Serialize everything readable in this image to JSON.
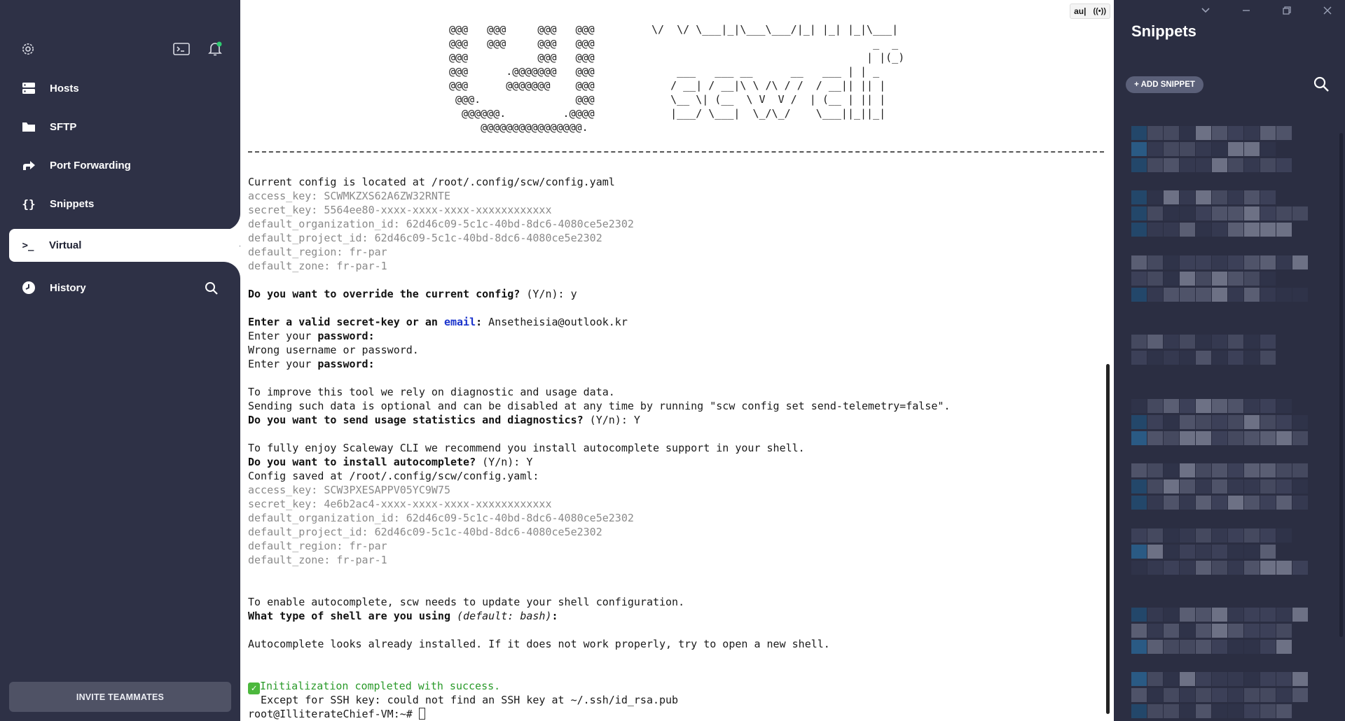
{
  "sidebar": {
    "nav": [
      {
        "label": "Hosts",
        "icon": "hosts-icon"
      },
      {
        "label": "SFTP",
        "icon": "folder-icon"
      },
      {
        "label": "Port Forwarding",
        "icon": "port-forwarding-icon"
      },
      {
        "label": "Snippets",
        "icon": "braces-icon"
      },
      {
        "label": "Virtual",
        "icon": "terminal-prompt-icon"
      },
      {
        "label": "History",
        "icon": "clock-icon"
      }
    ],
    "invite_label": "INVITE TEAMMATES",
    "active_item": "Virtual"
  },
  "terminal": {
    "ascii_left": [
      "@@@   @@@     @@@   @@@",
      "@@@   @@@     @@@   @@@",
      "@@@           @@@   @@@",
      "@@@      .@@@@@@@   @@@",
      "@@@      @@@@@@@    @@@",
      " @@@.               @@@",
      "  @@@@@@.         .@@@@",
      "     @@@@@@@@@@@@@@@@."
    ],
    "ascii_right": [
      "\\/  \\/ \\___|_|\\___\\___/|_| |_| |_|\\___|",
      "                                   _  _",
      "                                  | |(_)",
      "    ___   ___ __      __   ___ | | _",
      "   / __| / __|\\ \\ /\\ / /  / __|| || |",
      "   \\__ \\| (__  \\ V  V /  | (__ | || |",
      "   |___/ \\___|  \\_/\\_/    \\___||_||_|"
    ],
    "lines": [
      {
        "text": "Current config is located at /root/.config/scw/config.yaml"
      },
      {
        "text": "access_key: SCWMKZXS62A6ZW32RNTE",
        "dim": true
      },
      {
        "text": "secret_key: 5564ee80-xxxx-xxxx-xxxx-xxxxxxxxxxxx",
        "dim": true
      },
      {
        "text": "default_organization_id: 62d46c09-5c1c-40bd-8dc6-4080ce5e2302",
        "dim": true
      },
      {
        "text": "default_project_id: 62d46c09-5c1c-40bd-8dc6-4080ce5e2302",
        "dim": true
      },
      {
        "text": "default_region: fr-par",
        "dim": true
      },
      {
        "text": "default_zone: fr-par-1",
        "dim": true
      },
      {
        "text": ""
      },
      {
        "bold": "Do you want to override the current config?",
        "text": " (Y/n): y"
      },
      {
        "text": ""
      },
      {
        "bold": "Enter a valid secret-key or an ",
        "blue": "email",
        "bold2": ":",
        "text": " Ansetheisia@outlook.kr"
      },
      {
        "text": "Enter your ",
        "bold": "password:"
      },
      {
        "text": "Wrong username or password."
      },
      {
        "text": "Enter your ",
        "bold": "password:"
      },
      {
        "text": ""
      },
      {
        "text": "To improve this tool we rely on diagnostic and usage data."
      },
      {
        "text": "Sending such data is optional and can be disabled at any time by running \"scw config set send-telemetry=false\"."
      },
      {
        "bold": "Do you want to send usage statistics and diagnostics?",
        "text": " (Y/n): Y"
      },
      {
        "text": ""
      },
      {
        "text": "To fully enjoy Scaleway CLI we recommend you install autocomplete support in your shell."
      },
      {
        "bold": "Do you want to install autocomplete?",
        "text": " (Y/n): Y"
      },
      {
        "text": "Config saved at /root/.config/scw/config.yaml:"
      },
      {
        "text": "access_key: SCW3PXESAPPV05YC9W75",
        "dim": true
      },
      {
        "text": "secret_key: 4e6b2ac4-xxxx-xxxx-xxxx-xxxxxxxxxxxx",
        "dim": true
      },
      {
        "text": "default_organization_id: 62d46c09-5c1c-40bd-8dc6-4080ce5e2302",
        "dim": true
      },
      {
        "text": "default_project_id: 62d46c09-5c1c-40bd-8dc6-4080ce5e2302",
        "dim": true
      },
      {
        "text": "default_region: fr-par",
        "dim": true
      },
      {
        "text": "default_zone: fr-par-1",
        "dim": true
      },
      {
        "text": ""
      },
      {
        "text": ""
      },
      {
        "text": "To enable autocomplete, scw needs to update your shell configuration."
      },
      {
        "bold": "What type of shell are you using",
        "italic": " (default: bash)",
        "bold2": ":"
      },
      {
        "text": ""
      },
      {
        "text": "Autocomplete looks already installed. If it does not work properly, try to open a new shell."
      },
      {
        "text": ""
      },
      {
        "text": ""
      },
      {
        "green": "Initialization completed with success.",
        "check": true
      },
      {
        "text": "  Except for SSH key: could not find an SSH key at ~/.ssh/id_rsa.pub"
      },
      {
        "text": "root@IlliterateChief-VM:~# ",
        "cursor": true
      }
    ],
    "badge_left": "au|",
    "badge_right": "((•))"
  },
  "snippets": {
    "title": "Snippets",
    "add_label": "+ ADD SNIPPET"
  },
  "colors": {
    "sidebar_bg": "#2e3146",
    "terminal_bg": "#ffffff",
    "snippets_bg": "#2b2e42",
    "accent_green": "#4cb83d",
    "link_blue": "#1a33cc"
  }
}
